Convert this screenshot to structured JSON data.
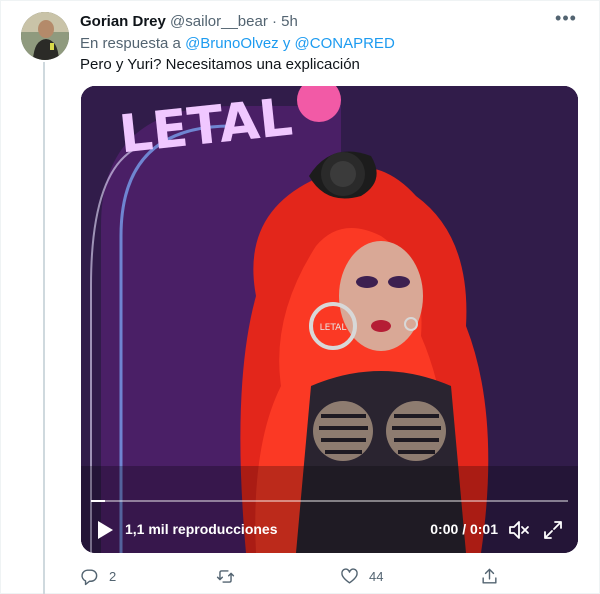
{
  "tweet": {
    "author_name": "Gorian Drey",
    "author_handle": "@sailor__bear",
    "separator": "·",
    "time": "5h",
    "reply_prefix": "En respuesta a",
    "mention_1": "@BrunoOlvez",
    "conjunction": "y",
    "mention_2": "@CONAPRED",
    "text": "Pero y Yuri? Necesitamos una explicación"
  },
  "media": {
    "sign_text": "LETAL",
    "earring_text": "LETAL",
    "views": "1,1 mil reproducciones",
    "time_current": "0:00",
    "time_separator": "/",
    "time_total": "0:01",
    "progress": 0.03
  },
  "actions": {
    "reply_count": "2",
    "retweet_count": "",
    "like_count": "44"
  },
  "colors": {
    "link": "#1d9bf0",
    "secondary_text": "#536471"
  }
}
